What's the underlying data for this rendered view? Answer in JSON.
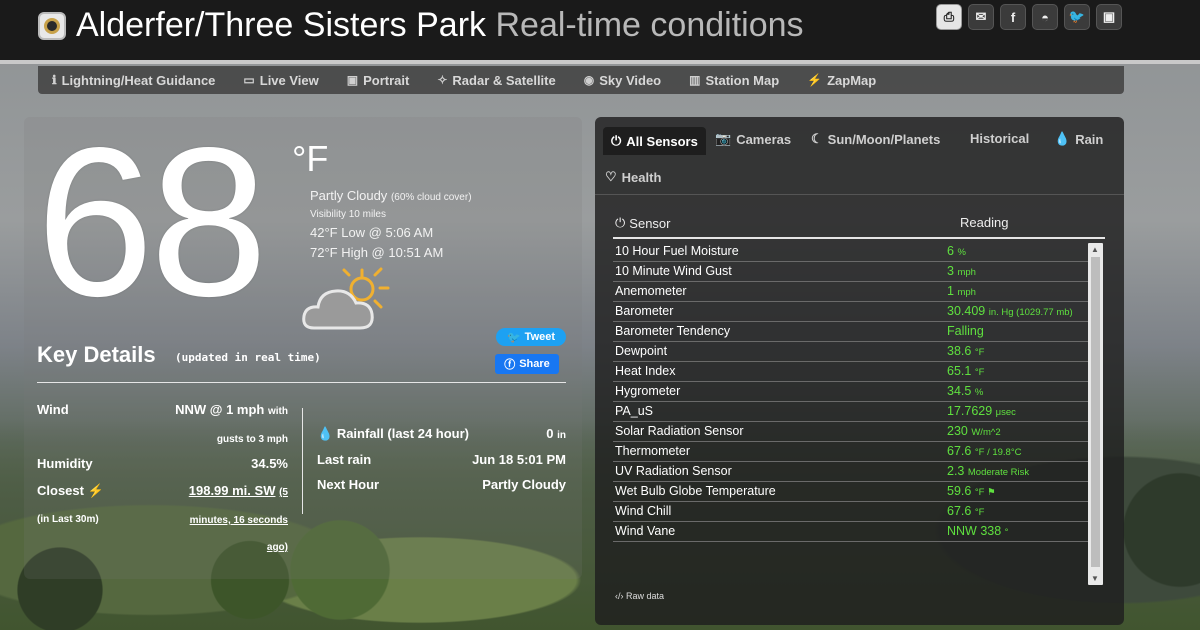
{
  "header": {
    "title": "Alderfer/Three Sisters Park",
    "subtitle": "Real-time conditions",
    "social": [
      {
        "icon": "pdf-icon",
        "glyph": "⎙"
      },
      {
        "icon": "email-icon",
        "glyph": "✉"
      },
      {
        "icon": "facebook-icon",
        "glyph": "f"
      },
      {
        "icon": "messenger-icon",
        "glyph": "◓"
      },
      {
        "icon": "twitter-icon",
        "glyph": "🐦"
      },
      {
        "icon": "embed-icon",
        "glyph": "▣"
      }
    ]
  },
  "nav": [
    {
      "label": "Lightning/Heat Guidance",
      "icon": "info-icon",
      "glyph": "ℹ"
    },
    {
      "label": "Live View",
      "icon": "tv-icon",
      "glyph": "▭"
    },
    {
      "label": "Portrait",
      "icon": "image-icon",
      "glyph": "▣"
    },
    {
      "label": "Radar & Satellite",
      "icon": "satellite-icon",
      "glyph": "✧"
    },
    {
      "label": "Sky Video",
      "icon": "video-icon",
      "glyph": "◉"
    },
    {
      "label": "Station Map",
      "icon": "map-icon",
      "glyph": "▥"
    },
    {
      "label": "ZapMap",
      "icon": "bolt-icon",
      "glyph": "⚡"
    }
  ],
  "current": {
    "temperature": "68",
    "unit": "°F",
    "condition": "Partly Cloudy",
    "cloud_cover": "(60% cloud cover)",
    "visibility": "Visibility 10 miles",
    "low": "42°F Low @ 5:06 AM",
    "high": "72°F High @ 10:51 AM"
  },
  "share": {
    "tweet": "Tweet",
    "facebook": "Share"
  },
  "key_details": {
    "title": "Key Details",
    "subtitle": "(updated in real time)",
    "wind_label": "Wind",
    "wind_value": "NNW @ 1 mph",
    "wind_gusts_a": "with",
    "wind_gusts_b": "gusts to 3 mph",
    "humidity_label": "Humidity",
    "humidity_value": "34.5%",
    "closest_label": "Closest",
    "closest_sub": "(in Last 30m)",
    "closest_value_a": "198.99 mi. SW",
    "closest_value_b": "(5",
    "closest_value_c": "minutes, 16 seconds",
    "closest_value_d": "ago)",
    "rainfall_label": "Rainfall (last 24 hour)",
    "rainfall_value": "0",
    "rainfall_unit": "in",
    "last_rain_label": "Last rain",
    "last_rain_value": "Jun 18 5:01 PM",
    "next_hour_label": "Next Hour",
    "next_hour_value": "Partly Cloudy"
  },
  "tabs": [
    {
      "label": "All Sensors",
      "icon": "power-icon",
      "glyph": "⏻"
    },
    {
      "label": "Cameras",
      "icon": "camera-icon",
      "glyph": "📷"
    },
    {
      "label": "Sun/Moon/Planets",
      "icon": "moon-icon",
      "glyph": "☾"
    },
    {
      "label": "Historical",
      "icon": "",
      "glyph": ""
    },
    {
      "label": "Rain",
      "icon": "drop-icon",
      "glyph": "💧"
    },
    {
      "label": "Health",
      "icon": "heartbeat-icon",
      "glyph": "♡"
    }
  ],
  "sensors": {
    "head_sensor": "Sensor",
    "head_reading": "Reading",
    "raw_data": "Raw data",
    "rows": [
      {
        "name": "10 Hour Fuel Moisture",
        "value": "6",
        "unit": "%"
      },
      {
        "name": "10 Minute Wind Gust",
        "value": "3",
        "unit": "mph"
      },
      {
        "name": "Anemometer",
        "value": "1",
        "unit": "mph"
      },
      {
        "name": "Barometer",
        "value": "30.409",
        "unit": "in. Hg (1029.77 mb)"
      },
      {
        "name": "Barometer Tendency",
        "value": "Falling",
        "unit": ""
      },
      {
        "name": "Dewpoint",
        "value": "38.6",
        "unit": "°F"
      },
      {
        "name": "Heat Index",
        "value": "65.1",
        "unit": "°F"
      },
      {
        "name": "Hygrometer",
        "value": "34.5",
        "unit": "%"
      },
      {
        "name": "PA_uS",
        "value": "17.7629",
        "unit": "μsec"
      },
      {
        "name": "Solar Radiation Sensor",
        "value": "230",
        "unit": "W/m^2"
      },
      {
        "name": "Thermometer",
        "value": "67.6",
        "unit": "°F / 19.8°C"
      },
      {
        "name": "UV Radiation Sensor",
        "value": "2.3",
        "unit": "Moderate Risk"
      },
      {
        "name": "Wet Bulb Globe Temperature",
        "value": "59.6",
        "unit": "°F ⚑"
      },
      {
        "name": "Wind Chill",
        "value": "67.6",
        "unit": "°F"
      },
      {
        "name": "Wind Vane",
        "value": "NNW 338",
        "unit": "°"
      }
    ]
  }
}
